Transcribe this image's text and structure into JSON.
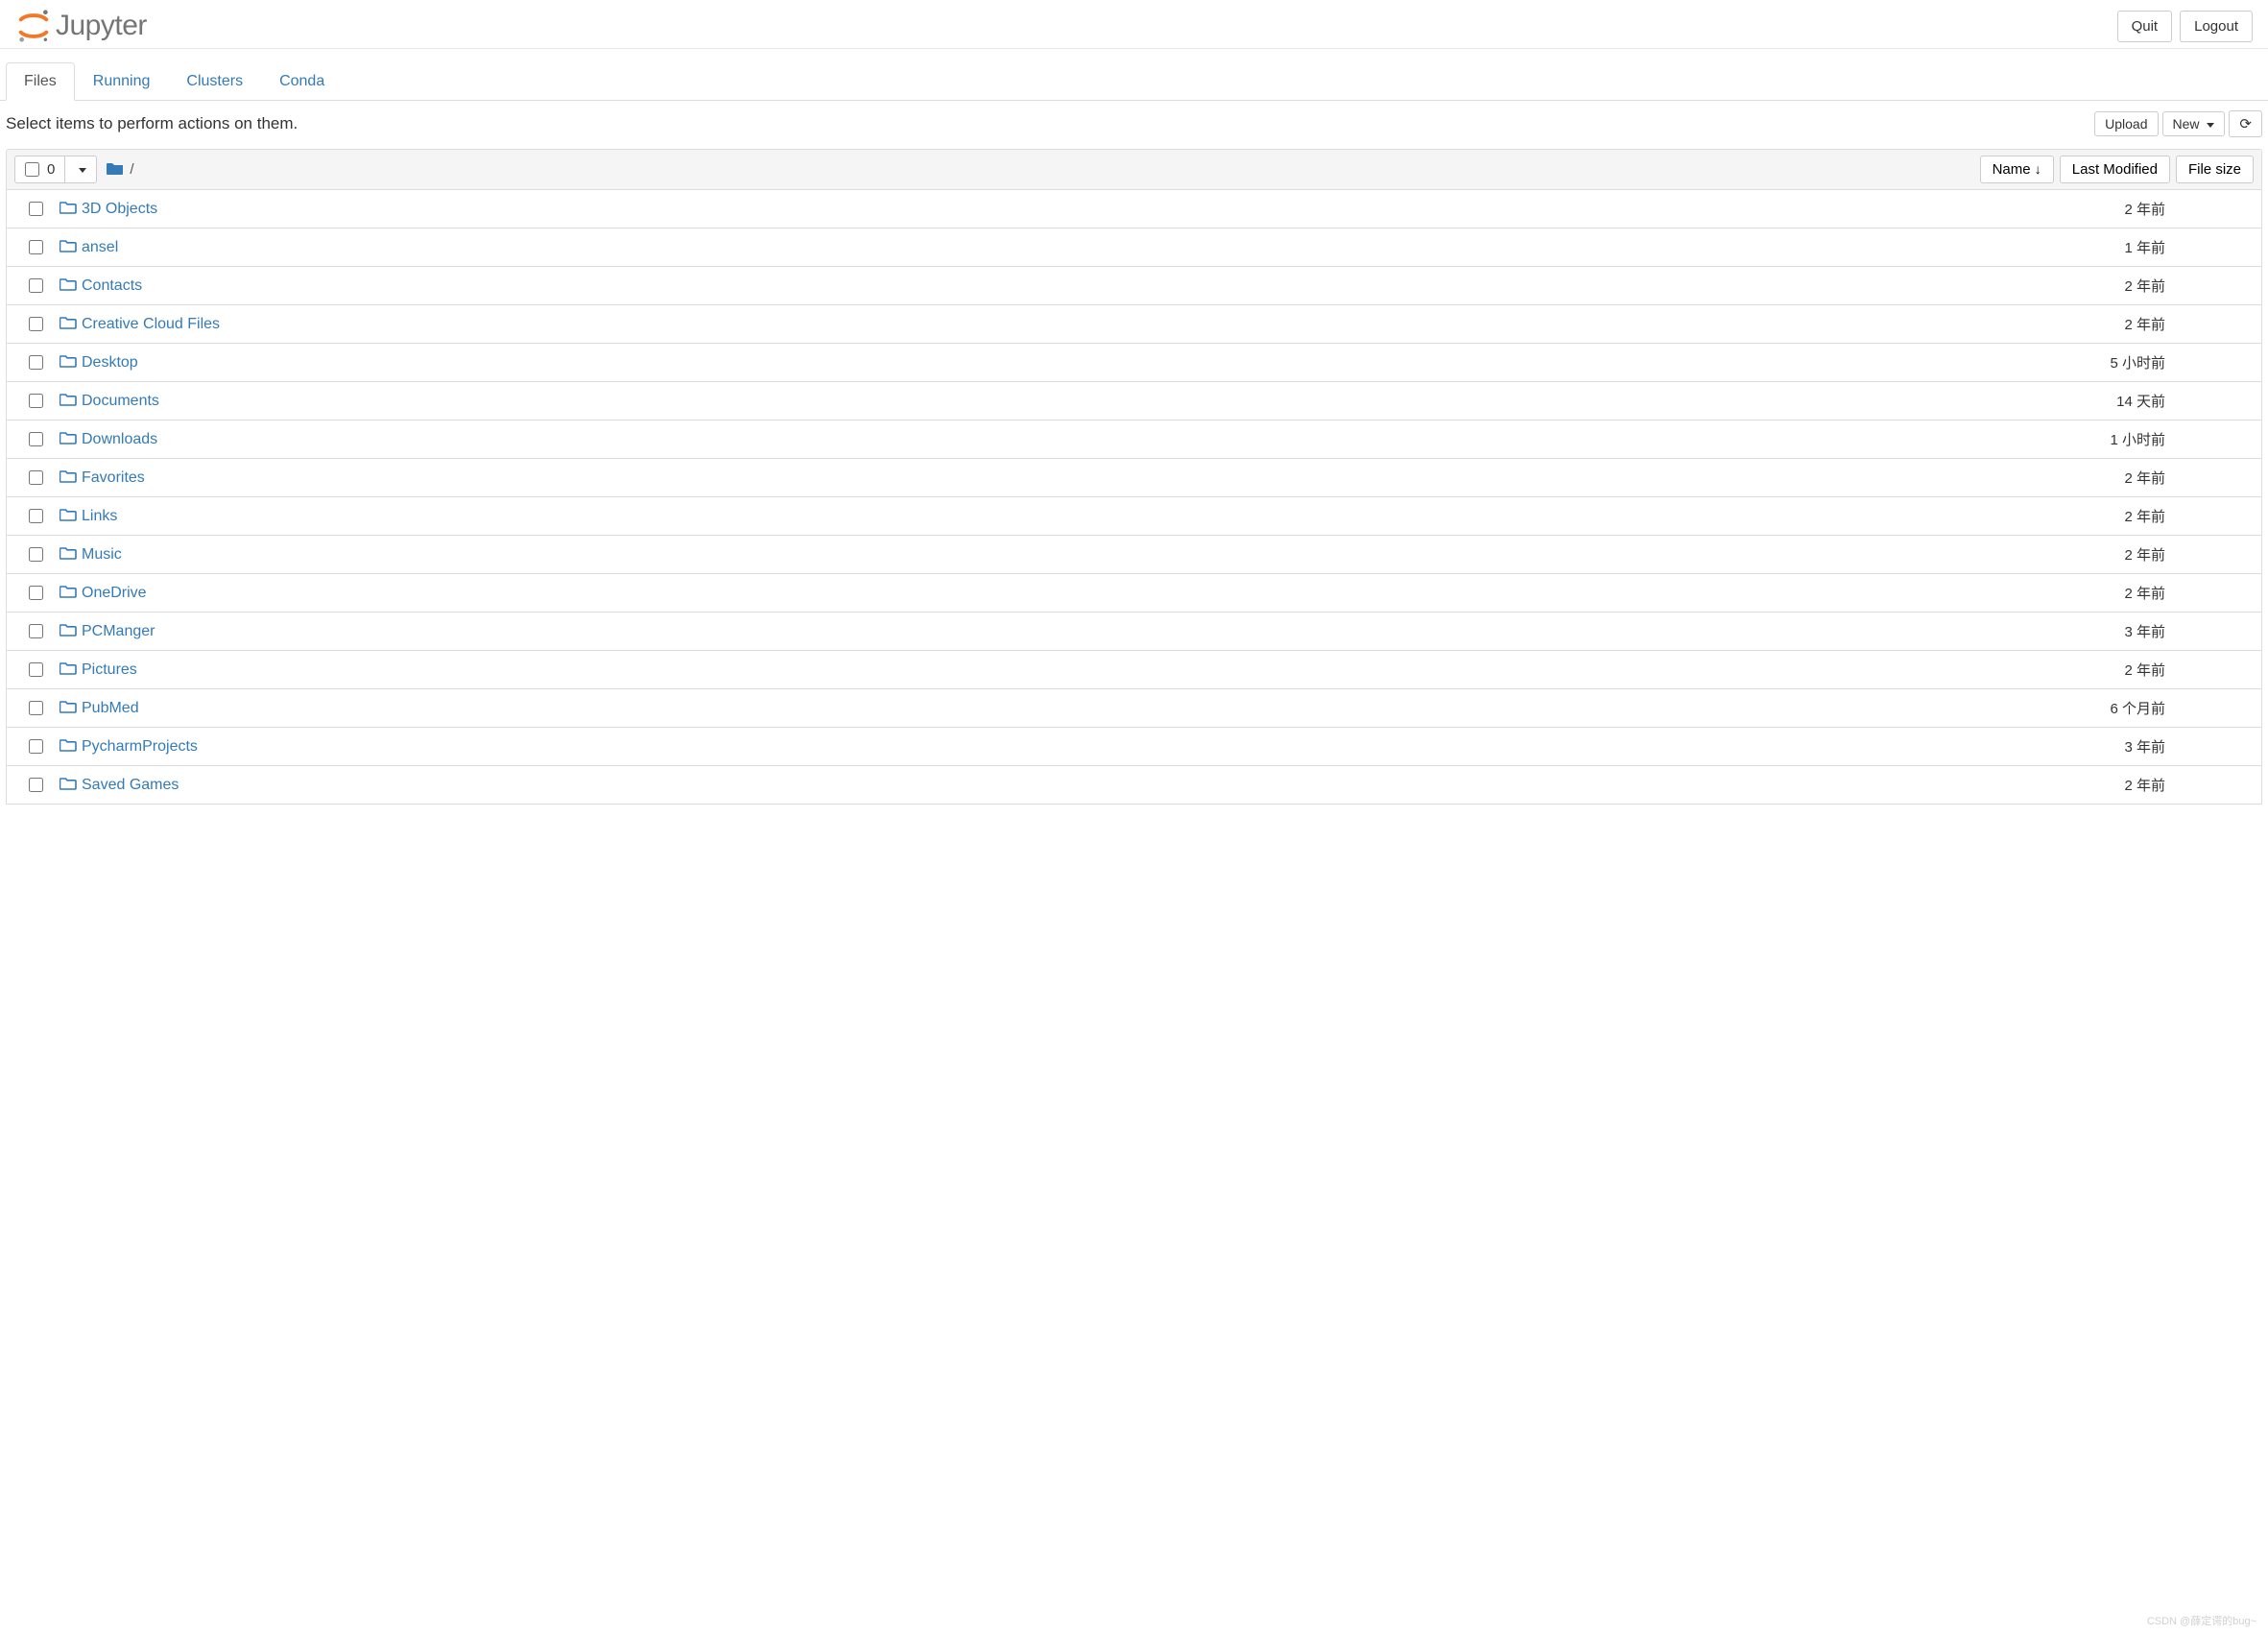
{
  "header": {
    "logo_text": "Jupyter",
    "quit_label": "Quit",
    "logout_label": "Logout"
  },
  "tabs": {
    "files": "Files",
    "running": "Running",
    "clusters": "Clusters",
    "conda": "Conda",
    "active": "files"
  },
  "toolbar": {
    "prompt": "Select items to perform actions on them.",
    "upload_label": "Upload",
    "new_label": "New",
    "refresh_title": "Refresh"
  },
  "list_header": {
    "selected_count": "0",
    "breadcrumb_sep": "/",
    "name_label": "Name",
    "modified_label": "Last Modified",
    "size_label": "File size"
  },
  "items": [
    {
      "name": "3D Objects",
      "modified": "2 年前",
      "size": ""
    },
    {
      "name": "ansel",
      "modified": "1 年前",
      "size": ""
    },
    {
      "name": "Contacts",
      "modified": "2 年前",
      "size": ""
    },
    {
      "name": "Creative Cloud Files",
      "modified": "2 年前",
      "size": ""
    },
    {
      "name": "Desktop",
      "modified": "5 小时前",
      "size": ""
    },
    {
      "name": "Documents",
      "modified": "14 天前",
      "size": ""
    },
    {
      "name": "Downloads",
      "modified": "1 小时前",
      "size": ""
    },
    {
      "name": "Favorites",
      "modified": "2 年前",
      "size": ""
    },
    {
      "name": "Links",
      "modified": "2 年前",
      "size": ""
    },
    {
      "name": "Music",
      "modified": "2 年前",
      "size": ""
    },
    {
      "name": "OneDrive",
      "modified": "2 年前",
      "size": ""
    },
    {
      "name": "PCManger",
      "modified": "3 年前",
      "size": ""
    },
    {
      "name": "Pictures",
      "modified": "2 年前",
      "size": ""
    },
    {
      "name": "PubMed",
      "modified": "6 个月前",
      "size": ""
    },
    {
      "name": "PycharmProjects",
      "modified": "3 年前",
      "size": ""
    },
    {
      "name": "Saved Games",
      "modified": "2 年前",
      "size": ""
    }
  ],
  "watermark": "CSDN @薛定谔的bug~"
}
